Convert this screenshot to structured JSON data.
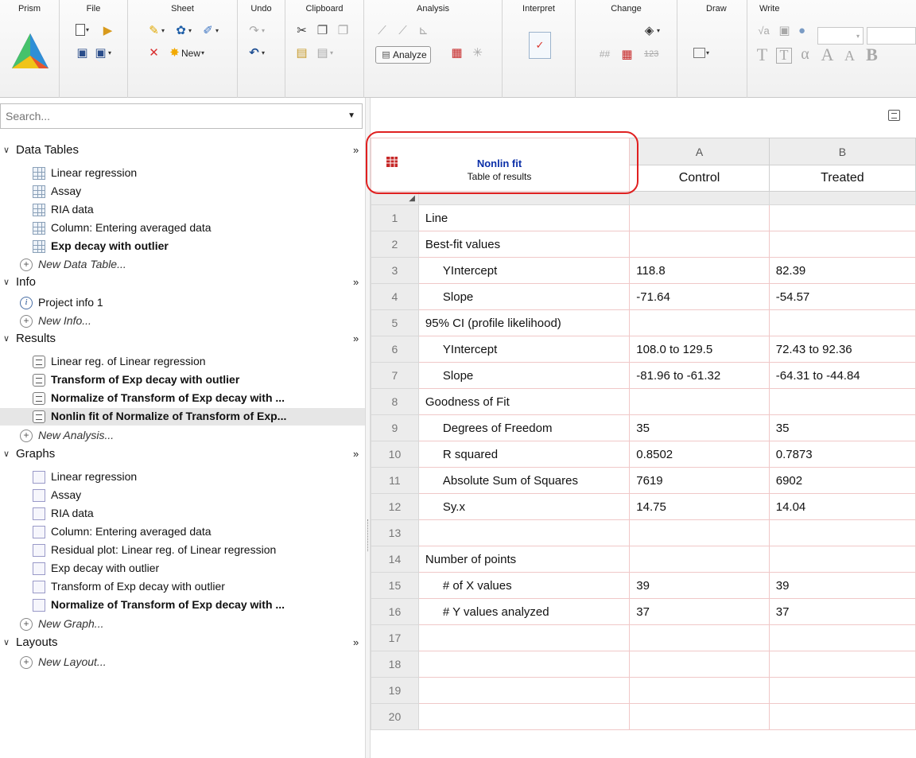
{
  "ribbon": {
    "groups": {
      "prism": "Prism",
      "file": "File",
      "sheet": "Sheet",
      "undo": "Undo",
      "clipboard": "Clipboard",
      "analysis": "Analysis",
      "interpret": "Interpret",
      "change": "Change",
      "draw": "Draw",
      "write": "Write"
    },
    "new_label": "New",
    "analyze_label": "Analyze",
    "write_greek": "α"
  },
  "nav": {
    "search_placeholder": "Search...",
    "sections": {
      "data_tables": {
        "title": "Data Tables",
        "items": [
          "Linear regression",
          "Assay",
          "RIA data",
          "Column: Entering averaged data",
          "Exp decay with outlier"
        ],
        "new": "New Data Table..."
      },
      "info": {
        "title": "Info",
        "items": [
          "Project info 1"
        ],
        "new": "New Info..."
      },
      "results": {
        "title": "Results",
        "items": [
          "Linear reg. of Linear regression",
          "Transform of Exp decay with outlier",
          "Normalize of Transform of Exp decay with ...",
          "Nonlin fit of Normalize of Transform of Exp..."
        ],
        "new": "New Analysis..."
      },
      "graphs": {
        "title": "Graphs",
        "items": [
          "Linear regression",
          "Assay",
          "RIA data",
          "Column: Entering averaged data",
          "Residual plot: Linear reg. of Linear regression",
          "Exp decay with outlier",
          "Transform of Exp decay with outlier",
          "Normalize of Transform of Exp decay with ..."
        ],
        "new": "New Graph..."
      },
      "layouts": {
        "title": "Layouts",
        "new": "New Layout..."
      }
    }
  },
  "sheet": {
    "corner_title": "Nonlin fit",
    "corner_subtitle": "Table of results",
    "col_letters": [
      "A",
      "B"
    ],
    "col_names": [
      "Control",
      "Treated"
    ],
    "rows": [
      {
        "n": "1",
        "label": "Line",
        "a": "",
        "b": ""
      },
      {
        "n": "2",
        "label": "Best-fit values",
        "a": "",
        "b": ""
      },
      {
        "n": "3",
        "label": "YIntercept",
        "a": "118.8",
        "b": "82.39"
      },
      {
        "n": "4",
        "label": "Slope",
        "a": "-71.64",
        "b": "-54.57"
      },
      {
        "n": "5",
        "label": "95% CI (profile likelihood)",
        "a": "",
        "b": ""
      },
      {
        "n": "6",
        "label": "YIntercept",
        "a": "108.0 to 129.5",
        "b": "72.43 to 92.36"
      },
      {
        "n": "7",
        "label": "Slope",
        "a": "-81.96 to -61.32",
        "b": "-64.31 to -44.84"
      },
      {
        "n": "8",
        "label": "Goodness of Fit",
        "a": "",
        "b": ""
      },
      {
        "n": "9",
        "label": "Degrees of Freedom",
        "a": "35",
        "b": "35"
      },
      {
        "n": "10",
        "label": "R squared",
        "a": "0.8502",
        "b": "0.7873"
      },
      {
        "n": "11",
        "label": "Absolute Sum of Squares",
        "a": "7619",
        "b": "6902"
      },
      {
        "n": "12",
        "label": "Sy.x",
        "a": "14.75",
        "b": "14.04"
      },
      {
        "n": "13",
        "label": "",
        "a": "",
        "b": ""
      },
      {
        "n": "14",
        "label": "Number of points",
        "a": "",
        "b": ""
      },
      {
        "n": "15",
        "label": "# of X values",
        "a": "39",
        "b": "39"
      },
      {
        "n": "16",
        "label": "# Y values analyzed",
        "a": "37",
        "b": "37"
      },
      {
        "n": "17",
        "label": "",
        "a": "",
        "b": ""
      },
      {
        "n": "18",
        "label": "",
        "a": "",
        "b": ""
      },
      {
        "n": "19",
        "label": "",
        "a": "",
        "b": ""
      },
      {
        "n": "20",
        "label": "",
        "a": "",
        "b": ""
      }
    ]
  },
  "colors": {
    "highlight": "#e02020",
    "corner_title": "#0b2fa8",
    "grid_border": "#f0c8c8"
  }
}
